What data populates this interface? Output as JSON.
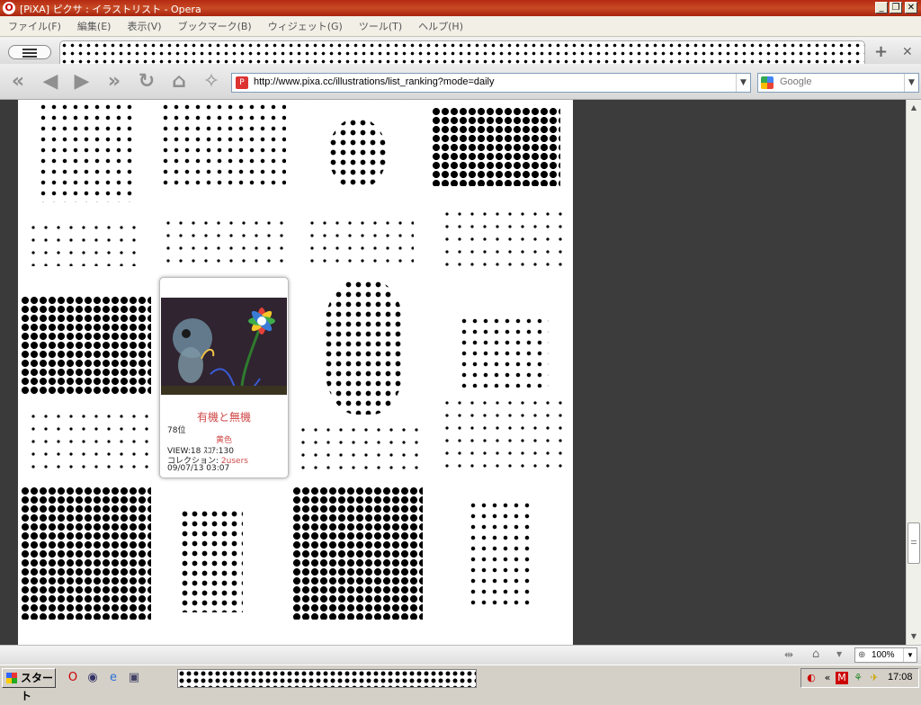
{
  "window": {
    "title": "[PiXA] ピクサ : イラストリスト - Opera",
    "minimize": "_",
    "maximize": "❐",
    "close": "✕"
  },
  "menubar": {
    "items": [
      "ファイル(F)",
      "編集(E)",
      "表示(V)",
      "ブックマーク(B)",
      "ウィジェット(G)",
      "ツール(T)",
      "ヘルプ(H)"
    ]
  },
  "tabs": {
    "new_tab": "+",
    "close_tab": "✕"
  },
  "navbar": {
    "url": "http://www.pixa.cc/illustrations/list_ranking?mode=daily",
    "search_engine": "Google",
    "favicon_letter": "P"
  },
  "card": {
    "title": "有機と無機",
    "rank": "78位",
    "author": "黄色",
    "stats": "VIEW:18  ｽｺｱ:130",
    "collection_label": "コレクション: ",
    "collection_value": "2users",
    "date": "09/07/13 03:07"
  },
  "statusbar": {
    "zoom": "100%"
  },
  "taskbar": {
    "start_label": "スタート",
    "clock": "17:08"
  },
  "colors": {
    "accent": "#d04a4a",
    "dark_panel": "#3c3c3c",
    "titlebar": "#b52a12"
  }
}
